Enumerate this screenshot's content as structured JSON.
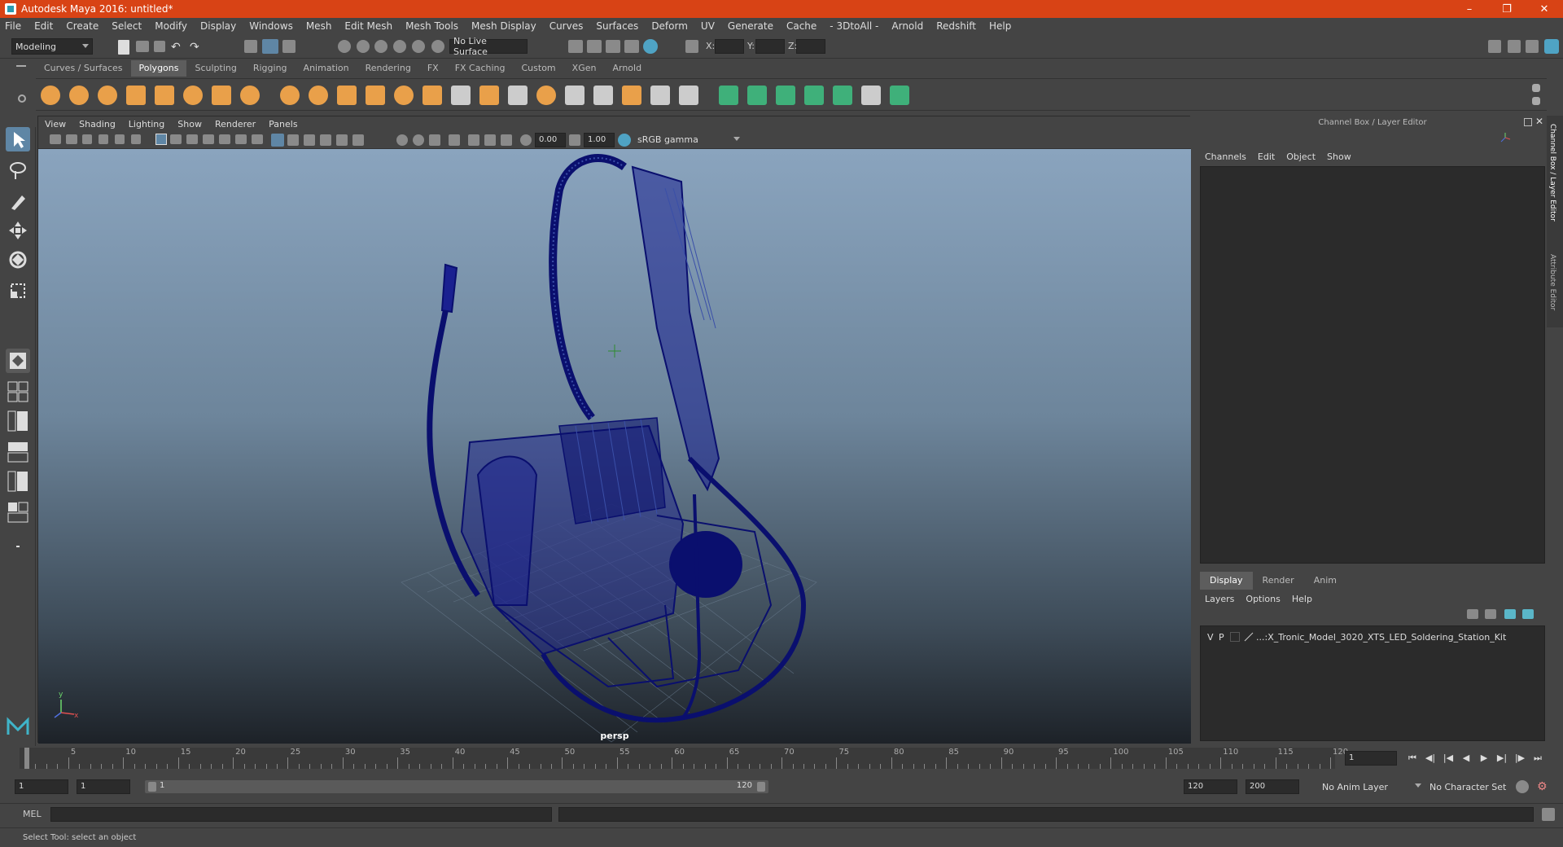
{
  "title": "Autodesk Maya 2016: untitled*",
  "menu": [
    "File",
    "Edit",
    "Create",
    "Select",
    "Modify",
    "Display",
    "Windows",
    "Mesh",
    "Edit Mesh",
    "Mesh Tools",
    "Mesh Display",
    "Curves",
    "Surfaces",
    "Deform",
    "UV",
    "Generate",
    "Cache",
    "- 3DtoAll -",
    "Arnold",
    "Redshift",
    "Help"
  ],
  "status": {
    "mode": "Modeling",
    "live_surface": "No Live Surface",
    "x_label": "X:",
    "y_label": "Y:",
    "z_label": "Z:"
  },
  "shelf_tabs": [
    "Curves / Surfaces",
    "Polygons",
    "Sculpting",
    "Rigging",
    "Animation",
    "Rendering",
    "FX",
    "FX Caching",
    "Custom",
    "XGen",
    "Arnold"
  ],
  "shelf_active": "Polygons",
  "viewport": {
    "menu": [
      "View",
      "Shading",
      "Lighting",
      "Show",
      "Renderer",
      "Panels"
    ],
    "exposure": "0.00",
    "gamma": "1.00",
    "colorspace": "sRGB gamma",
    "camera_label": "persp"
  },
  "right_panel": {
    "title": "Channel Box / Layer Editor",
    "menu": [
      "Channels",
      "Edit",
      "Object",
      "Show"
    ],
    "tabs": [
      "Display",
      "Render",
      "Anim"
    ],
    "tab_active": "Display",
    "layer_menu": [
      "Layers",
      "Options",
      "Help"
    ],
    "layer": {
      "v": "V",
      "p": "P",
      "name": "...:X_Tronic_Model_3020_XTS_LED_Soldering_Station_Kit"
    },
    "side_tabs": [
      "Channel Box / Layer Editor",
      "Attribute Editor"
    ]
  },
  "timeline": {
    "ticks": [
      "5",
      "10",
      "15",
      "20",
      "25",
      "30",
      "35",
      "40",
      "45",
      "50",
      "55",
      "60",
      "65",
      "70",
      "75",
      "80",
      "85",
      "90",
      "95",
      "100",
      "105",
      "110",
      "115",
      "120"
    ],
    "current_frame": "1"
  },
  "range": {
    "start": "1",
    "start2": "1",
    "slider_start": "1",
    "slider_end": "120",
    "end": "120",
    "end2": "200",
    "anim_layer": "No Anim Layer",
    "char_set": "No Character Set"
  },
  "mel_label": "MEL",
  "help_text": "Select Tool: select an object",
  "colors": {
    "titlebar": "#d84315",
    "wire": "#0a0f6e",
    "selected_tool": "#5f86a5"
  }
}
